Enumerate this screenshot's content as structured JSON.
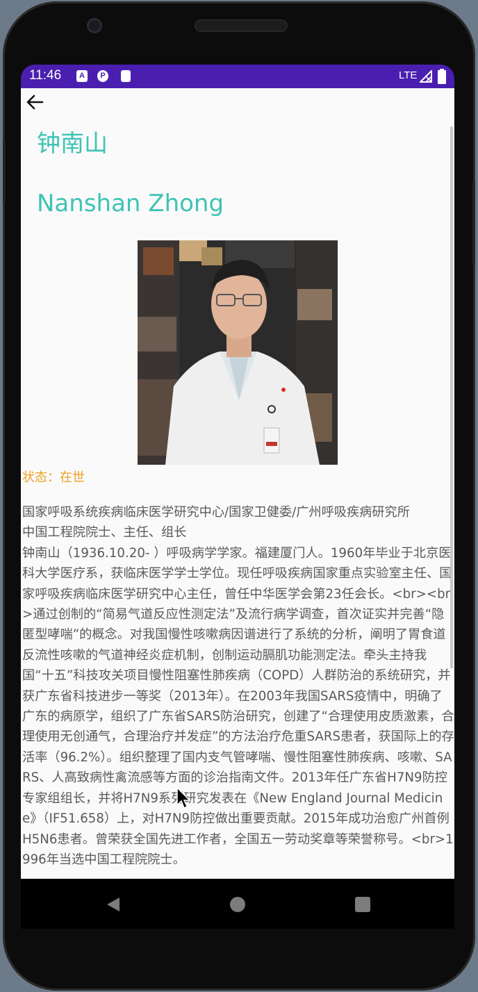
{
  "status_bar": {
    "time": "11:46",
    "icons": [
      "a-icon",
      "sync-icon",
      "sd-card-icon"
    ],
    "network": "LTE"
  },
  "toolbar": {
    "back_icon": "arrow-left-icon"
  },
  "profile": {
    "name_cn": "钟南山",
    "name_en": "Nanshan Zhong",
    "status": "状态：在世",
    "bio": "国家呼吸系统疾病临床医学研究中心/国家卫健委/广州呼吸疾病研究所\n中国工程院院士、主任、组长\n钟南山（1936.10.20- ）呼吸病学学家。福建厦门人。1960年毕业于北京医科大学医疗系，获临床医学学士学位。现任呼吸疾病国家重点实验室主任、国家呼吸疾病临床医学研究中心主任，曾任中华医学会第23任会长。<br><br>通过创制的“简易气道反应性测定法”及流行病学调查，首次证实并完善“隐匿型哮喘”的概念。对我国慢性咳嗽病因谱进行了系统的分析，阐明了胃食道反流性咳嗽的气道神经炎症机制，创制运动膈肌功能测定法。牵头主持我国“十五”科技攻关项目慢性阻塞性肺疾病（COPD）人群防治的系统研究，并获广东省科技进步一等奖（2013年）。在2003年我国SARS疫情中，明确了广东的病原学，组织了广东省SARS防治研究，创建了“合理使用皮质激素，合理使用无创通气，合理治疗并发症”的方法治疗危重SARS患者，获国际上的存活率（96.2%）。组织整理了国内支气管哮喘、慢性阻塞性肺疾病、咳嗽、SARS、人高致病性禽流感等方面的诊治指南文件。2013年任广东省H7N9防控专家组组长，并将H7N9系列研究发表在《New England Journal Medicine》（IF51.658）上，对H7N9防控做出重要贡献。2015年成功治愈广州首例H5N6患者。曾荣获全国先进工作者，全国五一劳动奖章等荣誉称号。<br>1996年当选中国工程院院士。"
  },
  "colors": {
    "status_bar": "#4a1fb0",
    "title": "#3ec3b4",
    "status_text": "#f0a020",
    "body_text": "#5a5a5a"
  }
}
